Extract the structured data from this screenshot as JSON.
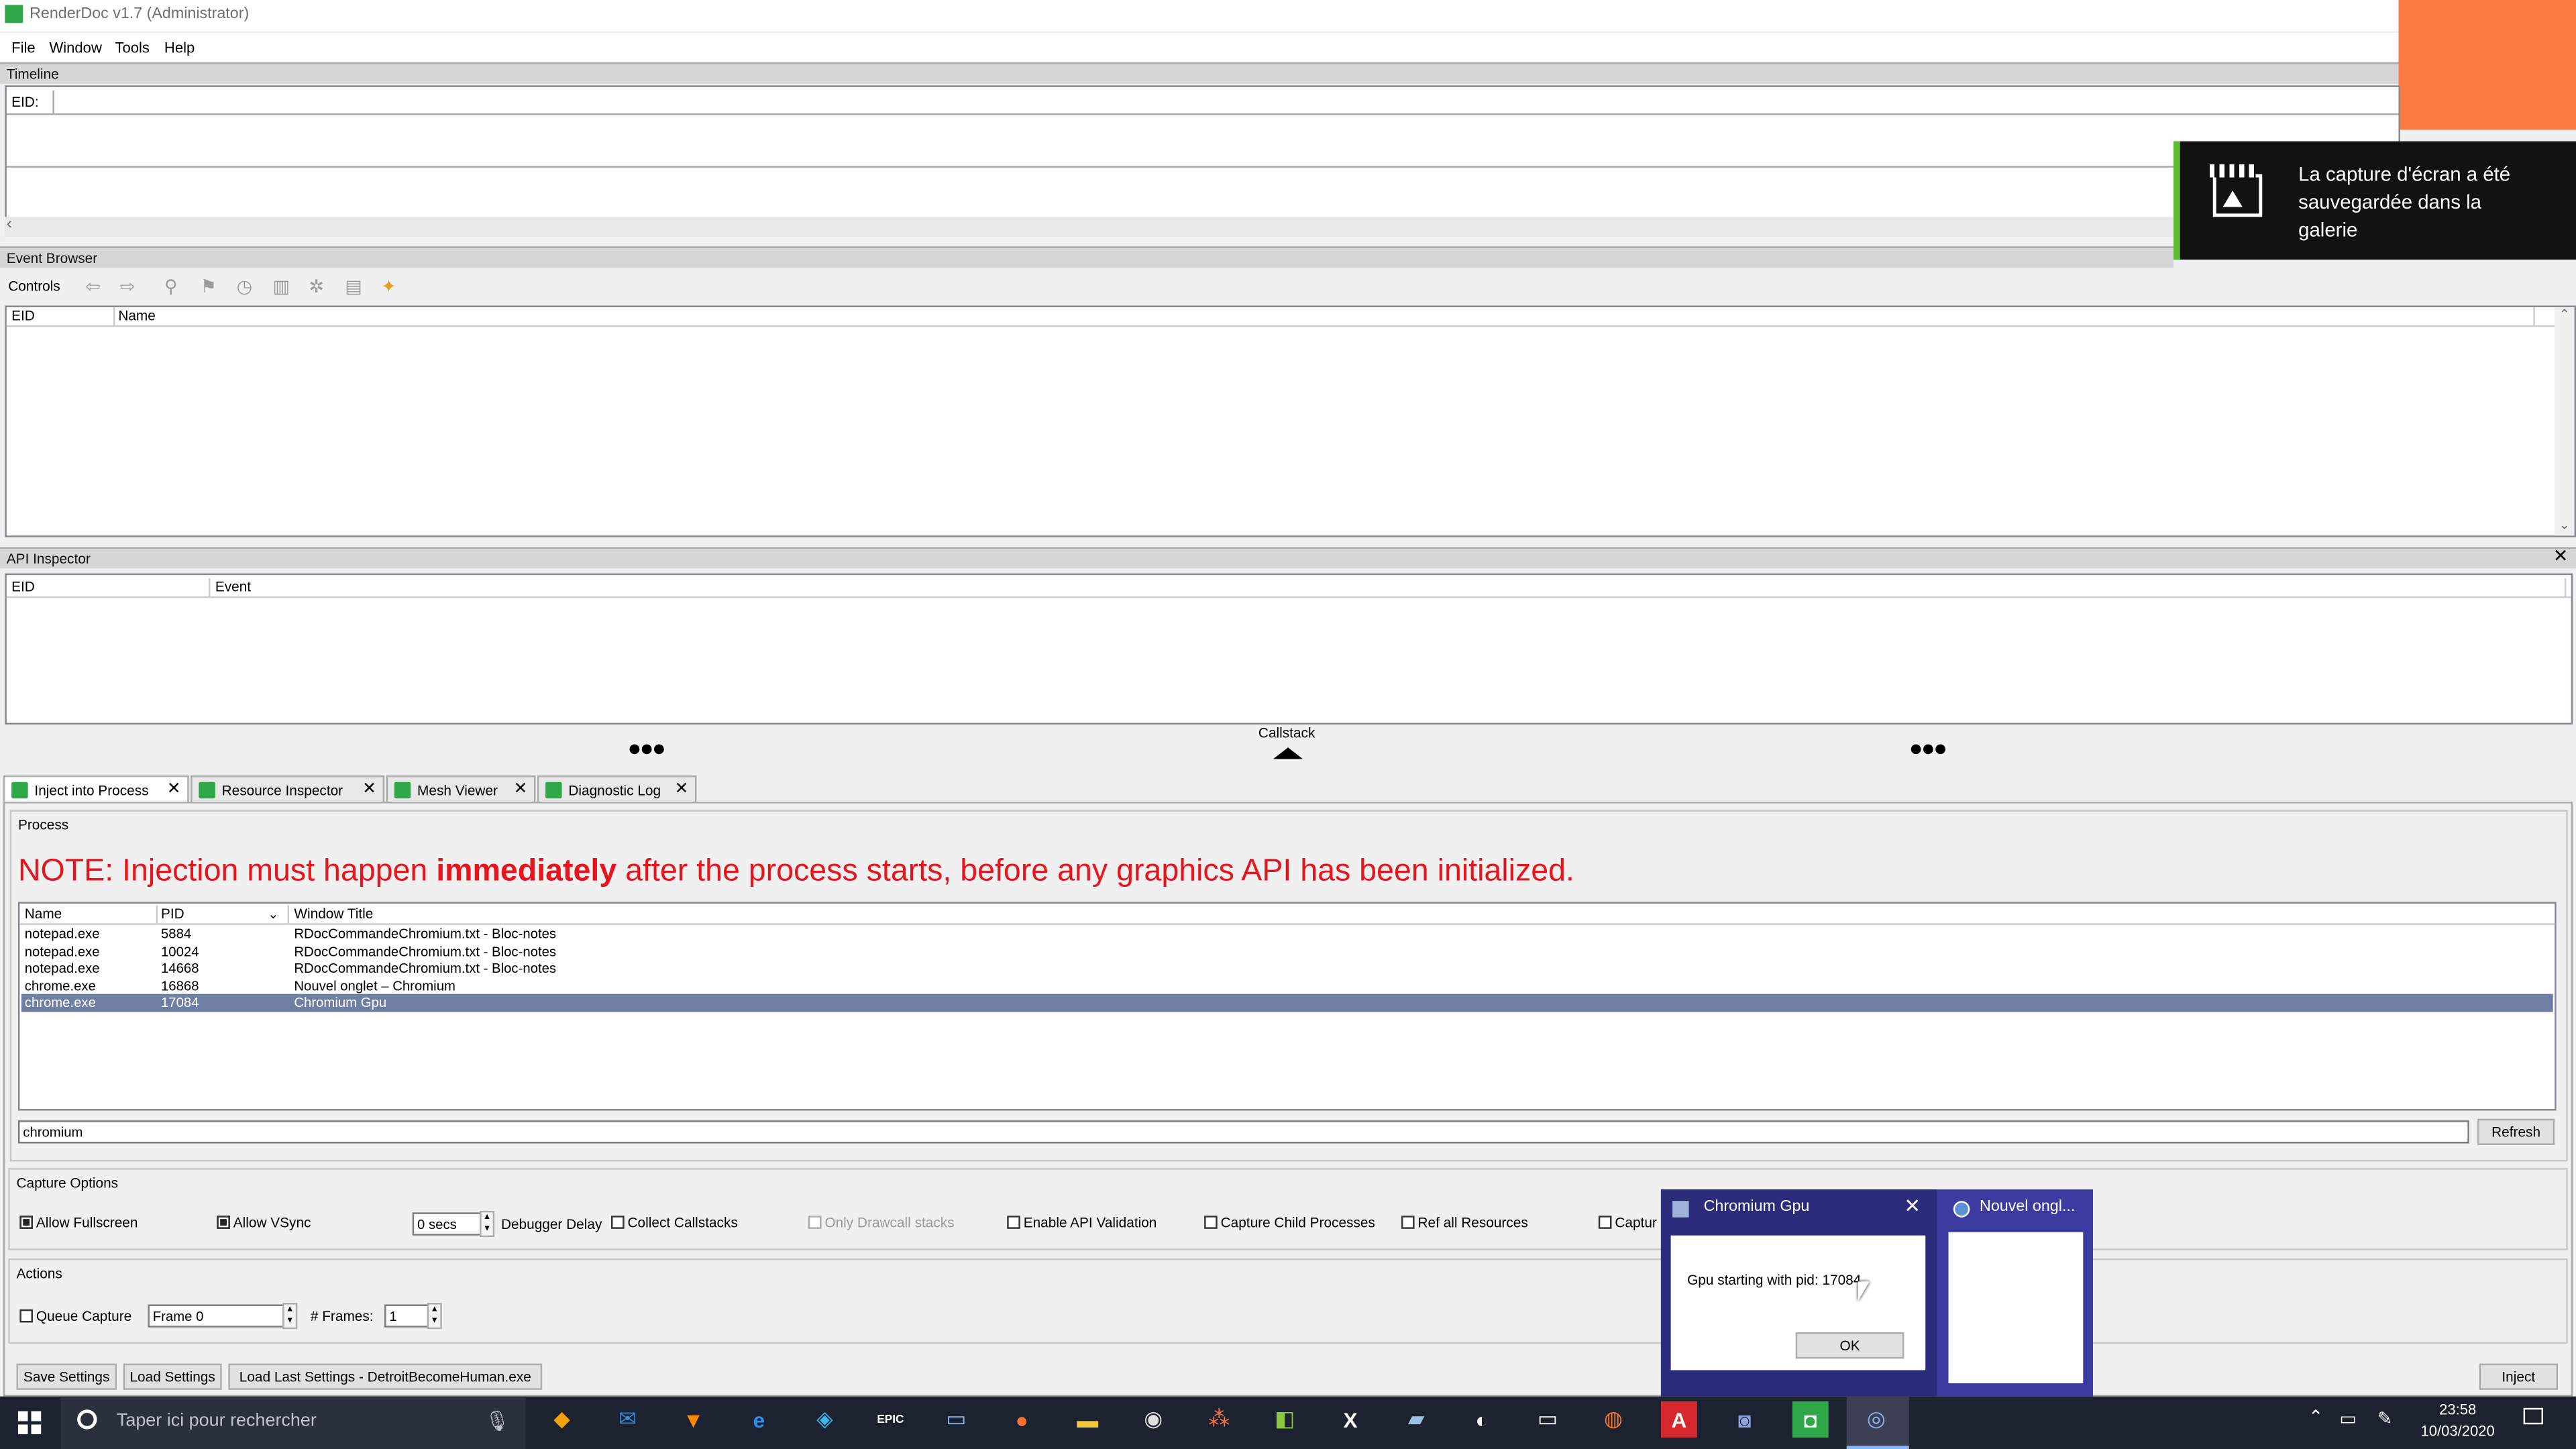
{
  "window": {
    "title": "RenderDoc v1.7 (Administrator)"
  },
  "menu": {
    "file": "File",
    "window": "Window",
    "tools": "Tools",
    "help": "Help"
  },
  "timeline": {
    "title": "Timeline",
    "eid_label": "EID:"
  },
  "toast": {
    "line1": "La capture d'écran a été",
    "line2": "sauvegardée dans la",
    "line3": "galerie"
  },
  "event_browser": {
    "title": "Event Browser",
    "controls_label": "Controls",
    "col_eid": "EID",
    "col_name": "Name"
  },
  "api_inspector": {
    "title": "API Inspector",
    "col_eid": "EID",
    "col_event": "Event",
    "callstack_label": "Callstack"
  },
  "tabs": [
    {
      "label": "Inject into Process"
    },
    {
      "label": "Resource Inspector"
    },
    {
      "label": "Mesh Viewer"
    },
    {
      "label": "Diagnostic Log"
    }
  ],
  "inject": {
    "process_label": "Process",
    "note_prefix": "NOTE: Injection must happen ",
    "note_bold": "immediately",
    "note_suffix": " after the process starts, before any graphics API has been initialized.",
    "col_name": "Name",
    "col_pid": "PID",
    "col_title": "Window Title",
    "processes": [
      {
        "name": "notepad.exe",
        "pid": "5884",
        "title": "RDocCommandeChromium.txt - Bloc-notes"
      },
      {
        "name": "notepad.exe",
        "pid": "10024",
        "title": "RDocCommandeChromium.txt - Bloc-notes"
      },
      {
        "name": "notepad.exe",
        "pid": "14668",
        "title": "RDocCommandeChromium.txt - Bloc-notes"
      },
      {
        "name": "chrome.exe",
        "pid": "16868",
        "title": "Nouvel onglet – Chromium"
      },
      {
        "name": "chrome.exe",
        "pid": "17084",
        "title": "Chromium Gpu"
      }
    ],
    "filter_value": "chromium",
    "refresh_label": "Refresh"
  },
  "capture_options": {
    "title": "Capture Options",
    "allow_fullscreen": "Allow Fullscreen",
    "allow_vsync": "Allow VSync",
    "delay_value": "0 secs",
    "debugger_delay": "Debugger Delay",
    "collect_callstacks": "Collect Callstacks",
    "only_drawcall": "Only Drawcall stacks",
    "enable_api_validation": "Enable API Validation",
    "capture_child": "Capture Child Processes",
    "ref_all": "Ref all Resources",
    "capture_truncated": "Captur"
  },
  "actions": {
    "title": "Actions",
    "queue_capture": "Queue Capture",
    "frame_value": "Frame 0",
    "frames_label": "# Frames:",
    "frames_value": "1"
  },
  "bottom": {
    "save_settings": "Save Settings",
    "load_settings": "Load Settings",
    "load_last": "Load Last Settings - DetroitBecomeHuman.exe",
    "inject": "Inject"
  },
  "popup": {
    "title": "Chromium Gpu",
    "message": "Gpu starting with pid: 17084",
    "ok": "OK",
    "second_title": "Nouvel ongl..."
  },
  "taskbar": {
    "search_placeholder": "Taper ici pour rechercher",
    "time": "23:58",
    "date": "10/03/2020"
  },
  "colors": {
    "note_red": "#e8141b",
    "selection": "#6f7fa3",
    "taskbar": "#1c2230",
    "popup_accent": "#3c3ba0"
  }
}
